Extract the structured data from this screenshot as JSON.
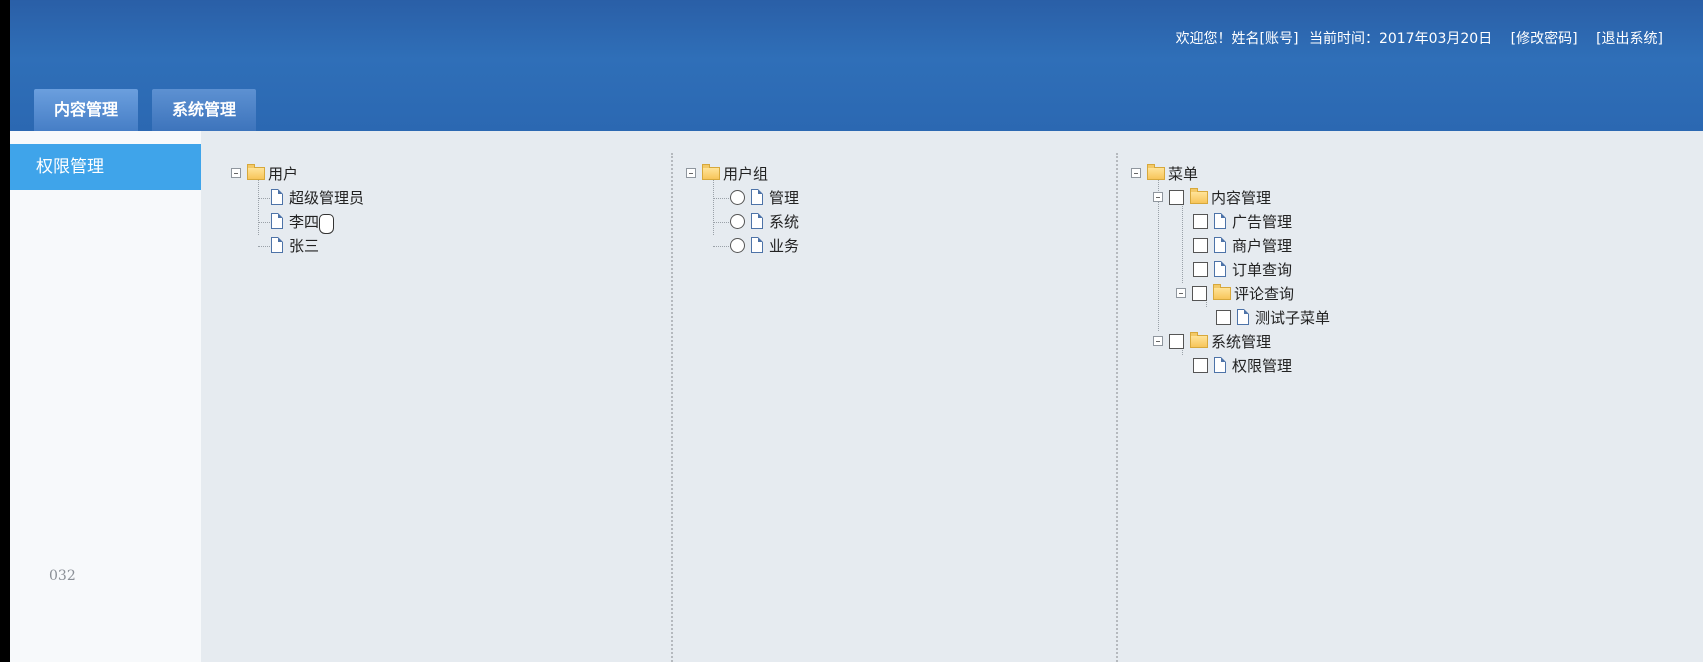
{
  "header": {
    "welcome": "欢迎您！姓名[账号]",
    "current_time_label": "当前时间：",
    "current_time": "2017年03月20日",
    "change_password": "[修改密码]",
    "logout": "[退出系统]"
  },
  "nav": {
    "tabs": [
      {
        "label": "内容管理"
      },
      {
        "label": "系统管理"
      }
    ]
  },
  "sidebar": {
    "items": [
      {
        "label": "权限管理"
      }
    ],
    "page_number": "032"
  },
  "trees": {
    "users": {
      "root": "用户",
      "children": [
        "超级管理员",
        "李四",
        "张三"
      ]
    },
    "groups": {
      "root": "用户组",
      "children": [
        "管理",
        "系统",
        "业务"
      ]
    },
    "menus": {
      "root": "菜单",
      "children": [
        {
          "label": "内容管理",
          "children": [
            {
              "label": "广告管理"
            },
            {
              "label": "商户管理"
            },
            {
              "label": "订单查询"
            },
            {
              "label": "评论查询",
              "children": [
                {
                  "label": "测试子菜单"
                }
              ]
            }
          ]
        },
        {
          "label": "系统管理",
          "children": [
            {
              "label": "权限管理"
            }
          ]
        }
      ]
    }
  },
  "icons": {
    "toggle": "tree-collapse-icon",
    "folder": "folder-icon",
    "file": "file-icon",
    "cursor": "hand-pointer-icon"
  },
  "colors": {
    "header": "#2f6fb8",
    "sidebar_active": "#3fa4ea",
    "content_bg": "#e6ebf0"
  }
}
